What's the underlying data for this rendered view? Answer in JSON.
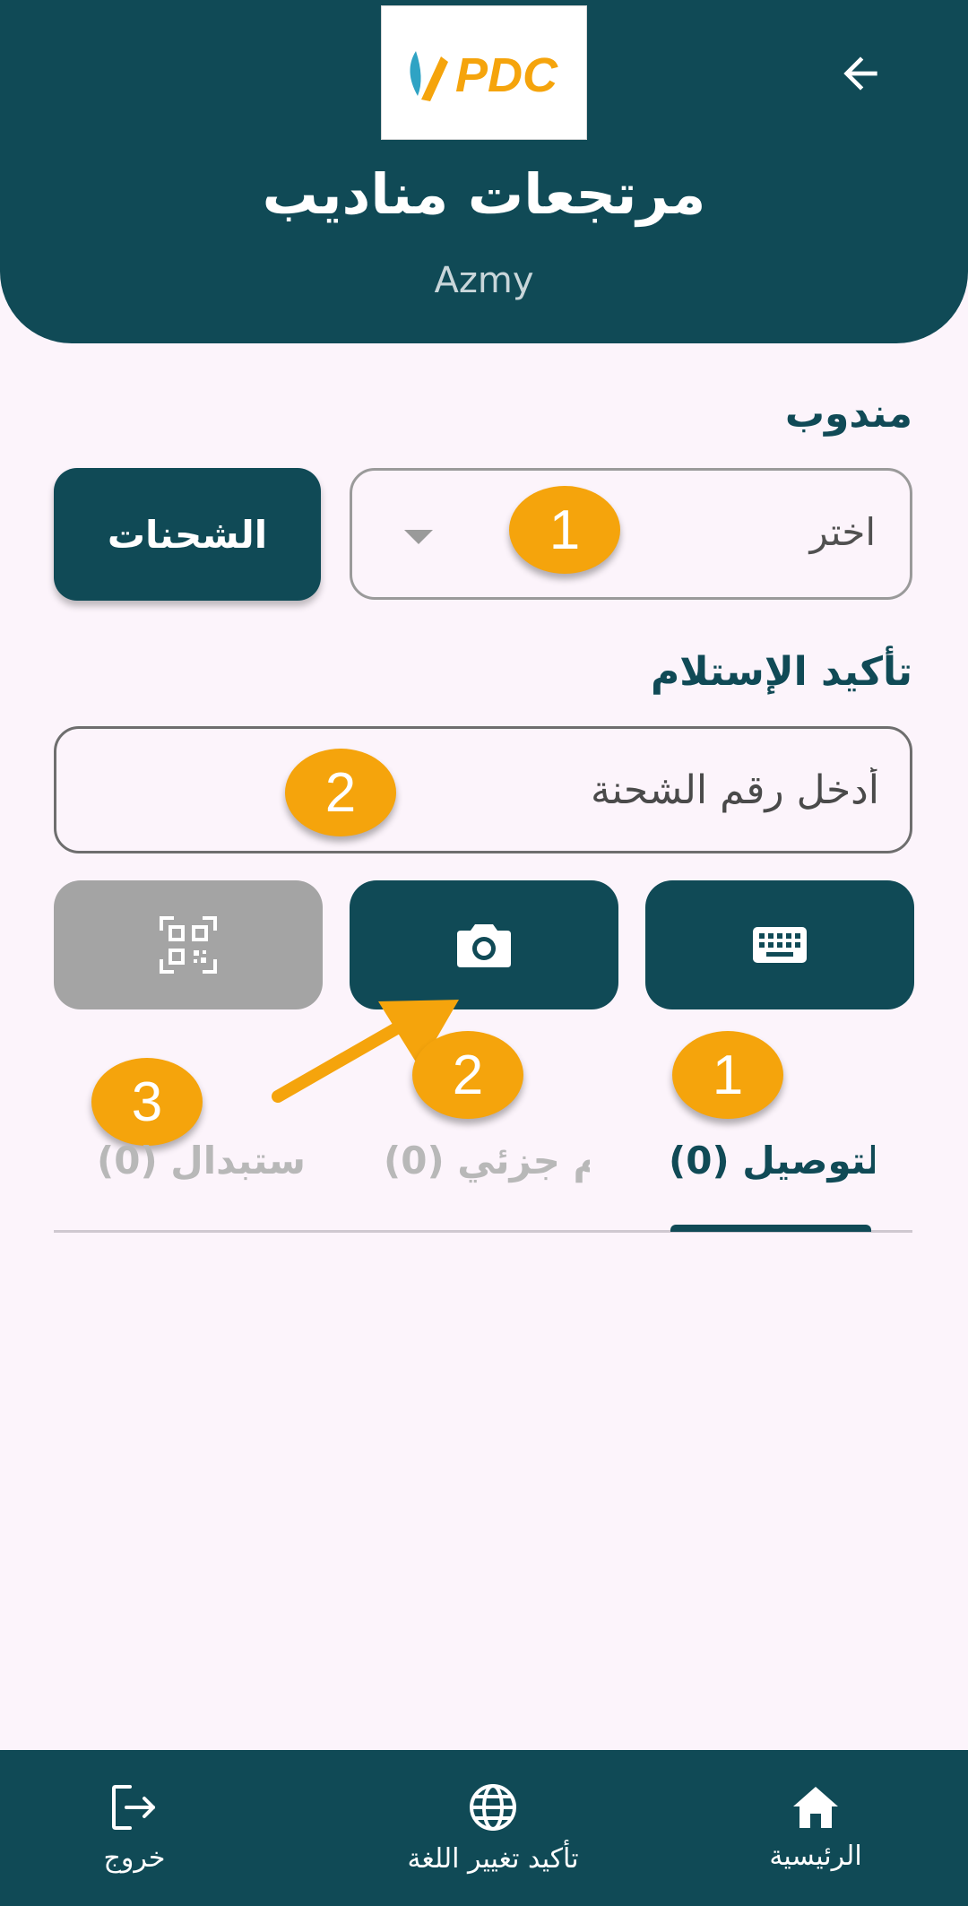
{
  "header": {
    "title": "مرتجعات مناديب",
    "subtitle": "Azmy",
    "logo_text": "PDC",
    "back_icon": "arrow-left-icon"
  },
  "representative": {
    "label": "مندوب",
    "dropdown_value": "اختر",
    "shipments_button": "الشحنات"
  },
  "confirmation": {
    "label": "تأكيد الإستلام",
    "input_placeholder": "أدخل رقم الشحنة",
    "buttons": {
      "keyboard_icon": "keyboard-icon",
      "camera_icon": "camera-icon",
      "qr_icon": "qr-scan-icon"
    }
  },
  "tabs": [
    {
      "label": "لتوصيل (0)"
    },
    {
      "label": "م جزئي (0)"
    },
    {
      "label": "ستبدال (0)"
    }
  ],
  "badges": {
    "b1_dropdown": "1",
    "b2_input": "2",
    "b1_tab": "1",
    "b2_tab": "2",
    "b3_tab": "3"
  },
  "bottom_nav": {
    "home": "الرئيسية",
    "language": "تأكيد تغيير اللغة",
    "exit": "خروج"
  },
  "colors": {
    "primary": "#104A56",
    "background": "#FCF4FB",
    "badge": "#F5A40C",
    "disabled": "#A4A4A4",
    "logo_orange": "#F5A40C",
    "logo_blue": "#2FA3C4"
  }
}
